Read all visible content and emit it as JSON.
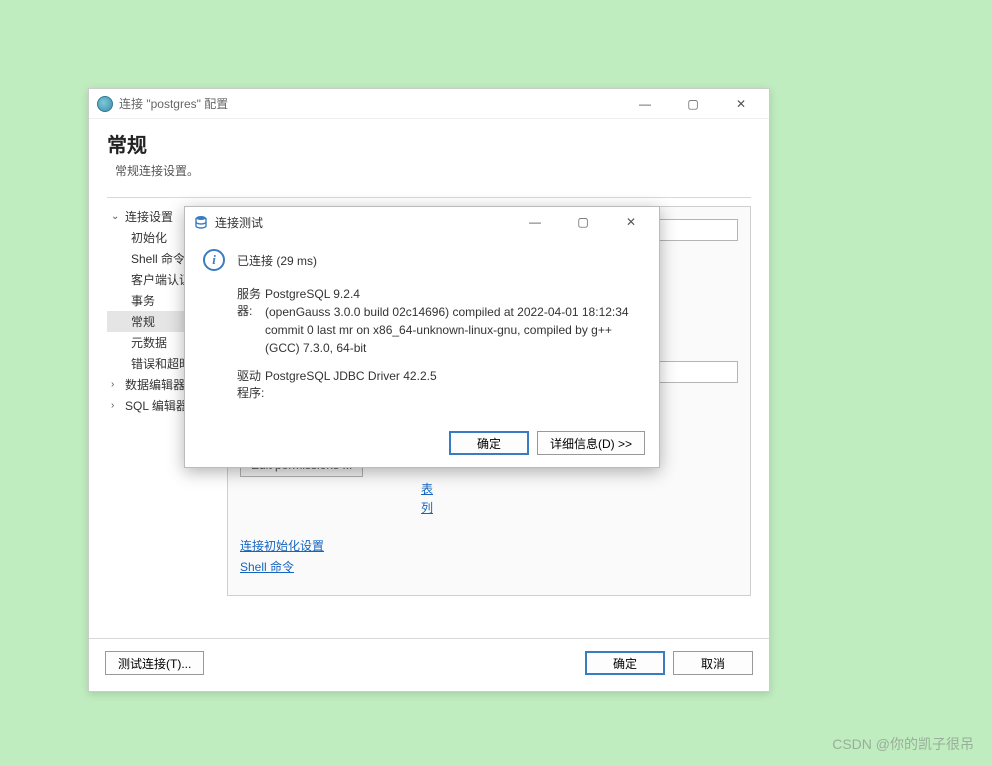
{
  "mainWindow": {
    "title": "连接 \"postgres\" 配置",
    "pageTitle": "常规",
    "pageSubtitle": "常规连接设置。",
    "sidebar": {
      "root": "连接设置",
      "items": [
        "初始化",
        "Shell 命令",
        "客户端认证",
        "事务",
        "常规",
        "元数据",
        "错误和超时"
      ],
      "selectedIndex": 4,
      "extra1": "数据编辑器",
      "extra2": "SQL 编辑器"
    },
    "content": {
      "permissionsBtn": "Edit permissions ...",
      "link1": "连接初始化设置",
      "link2": "Shell 命令",
      "midLinks": [
        "表",
        "列"
      ]
    },
    "footer": {
      "testBtn": "测试连接(T)...",
      "okBtn": "确定",
      "cancelBtn": "取消"
    }
  },
  "modal": {
    "title": "连接测试",
    "statusText": "已连接 (29 ms)",
    "serverLabel": "服务器:",
    "serverValue": "PostgreSQL 9.2.4\n(openGauss 3.0.0 build 02c14696) compiled at 2022-04-01 18:12:34 commit 0 last mr   on x86_64-unknown-linux-gnu, compiled by g++ (GCC) 7.3.0, 64-bit",
    "driverLabel": "驱动程序:",
    "driverValue": "PostgreSQL JDBC Driver 42.2.5",
    "okBtn": "确定",
    "detailsBtn": "详细信息(D) >>"
  },
  "watermark": "CSDN @你的凯子很吊"
}
